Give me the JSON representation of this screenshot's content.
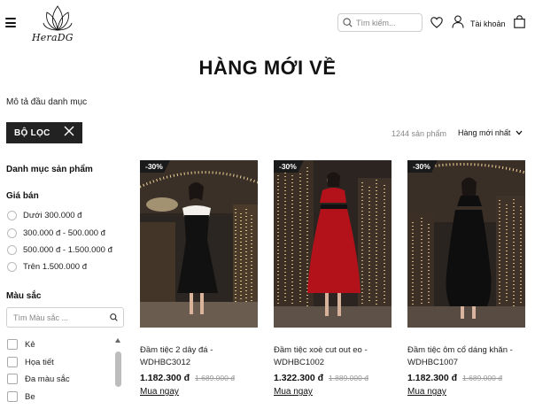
{
  "header": {
    "logo_text": "HeraDG",
    "search_placeholder": "Tìm kiếm...",
    "account_label": "Tài khoản"
  },
  "page": {
    "title": "HÀNG MỚI VỀ",
    "category_description": "Mô tả đầu danh mục"
  },
  "toolbar": {
    "filter_label": "BỘ LỌC",
    "product_count": "1244 sản phẩm",
    "sort_label": "Hàng mới nhất"
  },
  "sidebar": {
    "category_heading": "Danh mục sản phẩm",
    "price_heading": "Giá bán",
    "price_options": [
      "Dưới 300.000 đ",
      "300.000 đ - 500.000 đ",
      "500.000 đ - 1.500.000 đ",
      "Trên 1.500.000 đ"
    ],
    "color_heading": "Màu sắc",
    "color_search_placeholder": "Tìm Màu sắc ...",
    "color_options": [
      "Kẻ",
      "Họa tiết",
      "Đa màu sắc",
      "Be"
    ]
  },
  "products": [
    {
      "badge": "-30%",
      "name": "Đầm tiệc 2 dây đá - WDHBC3012",
      "price": "1.182.300 đ",
      "old_price": "1.689.000 đ",
      "buy_label": "Mua ngay",
      "dress_color": "#111111"
    },
    {
      "badge": "-30%",
      "name": "Đầm tiệc xoè cut out eo - WDHBC1002",
      "price": "1.322.300 đ",
      "old_price": "1.889.000 đ",
      "buy_label": "Mua ngay",
      "dress_color": "#b3121b"
    },
    {
      "badge": "-30%",
      "name": "Đầm tiệc ôm cổ dáng khăn - WDHBC1007",
      "price": "1.182.300 đ",
      "old_price": "1.689.000 đ",
      "buy_label": "Mua ngay",
      "dress_color": "#0e0e0e"
    }
  ]
}
